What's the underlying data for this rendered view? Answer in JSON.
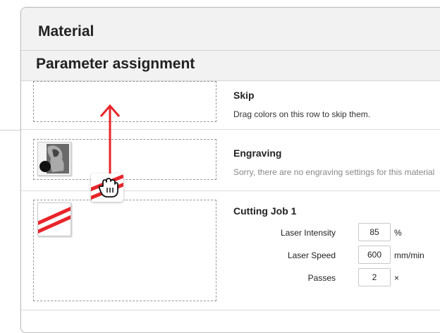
{
  "material": {
    "title": "Material"
  },
  "parameter_assignment": {
    "title": "Parameter assignment"
  },
  "rows": [
    {
      "title": "Skip",
      "description": "Drag colors on this row to skip them."
    },
    {
      "title": "Engraving",
      "description": "Sorry, there are no engraving settings for this material"
    },
    {
      "title": "Cutting Job 1"
    }
  ],
  "cutting_params": [
    {
      "label": "Laser Intensity",
      "value": "85",
      "unit": "%"
    },
    {
      "label": "Laser Speed",
      "value": "600",
      "unit": "mm/min"
    },
    {
      "label": "Passes",
      "value": "2",
      "unit": "×"
    }
  ],
  "colors": {
    "accent_red": "#e8252b",
    "dashed_border": "#999999"
  },
  "icons": {
    "drag_cursor": "grab-hand-icon",
    "arrow": "arrow-up-icon"
  }
}
